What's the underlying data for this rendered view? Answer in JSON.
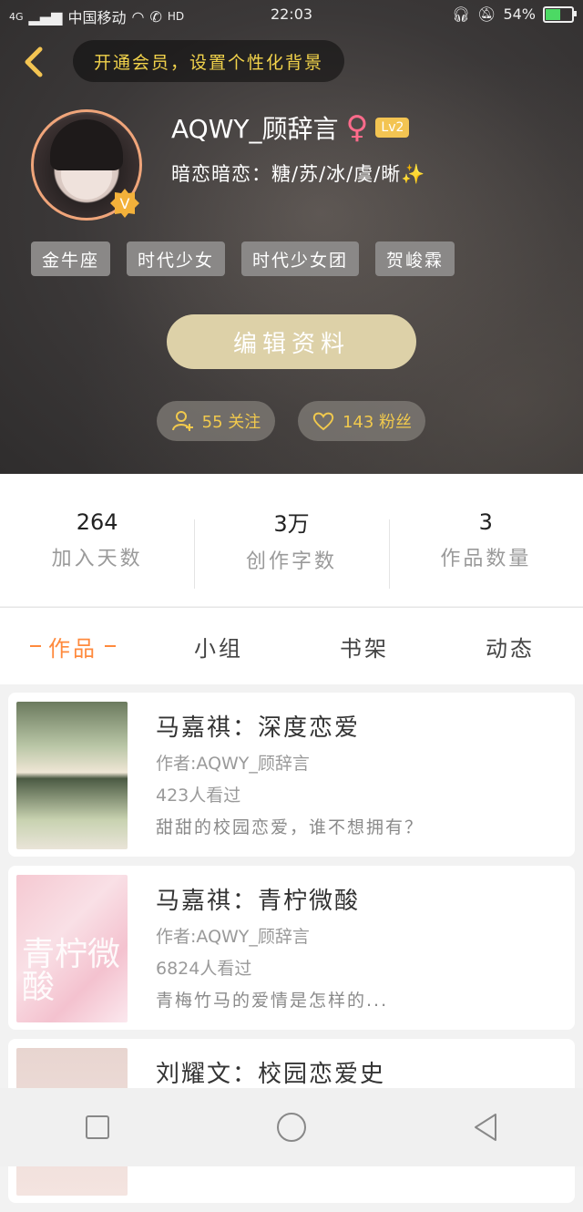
{
  "status_bar": {
    "signal": "4G",
    "carrier": "中国移动",
    "hd": "HD",
    "time": "22:03",
    "battery": "54%"
  },
  "header": {
    "vip_banner": "开通会员，设置个性化背景",
    "username": "AQWY_顾辞言",
    "gender_symbol": "♀",
    "level": "Lv2",
    "bio": "暗恋暗恋：糖/苏/冰/虞/晰✨",
    "tags": [
      "金牛座",
      "时代少女",
      "时代少女团",
      "贺峻霖"
    ],
    "edit_button": "编辑资料",
    "following": "55 关注",
    "followers": "143 粉丝"
  },
  "stats": [
    {
      "value": "264",
      "label": "加入天数"
    },
    {
      "value": "3万",
      "label": "创作字数"
    },
    {
      "value": "3",
      "label": "作品数量"
    }
  ],
  "tabs": [
    "作品",
    "小组",
    "书架",
    "动态"
  ],
  "works": [
    {
      "title": "马嘉祺：深度恋爱",
      "author": "作者:AQWY_顾辞言",
      "views": "423人看过",
      "desc": "甜甜的校园恋爱，谁不想拥有？"
    },
    {
      "title": "马嘉祺：青柠微酸",
      "author": "作者:AQWY_顾辞言",
      "views": "6824人看过",
      "desc": "青梅竹马的爱情是怎样的...",
      "cover_text": "青柠微酸"
    },
    {
      "title": "刘耀文：校园恋爱史",
      "author": "",
      "views": "",
      "desc": ""
    }
  ],
  "colors": {
    "accent": "#ff8a3d",
    "gold": "#f1c94d",
    "edit_button": "#ddd1a8"
  }
}
